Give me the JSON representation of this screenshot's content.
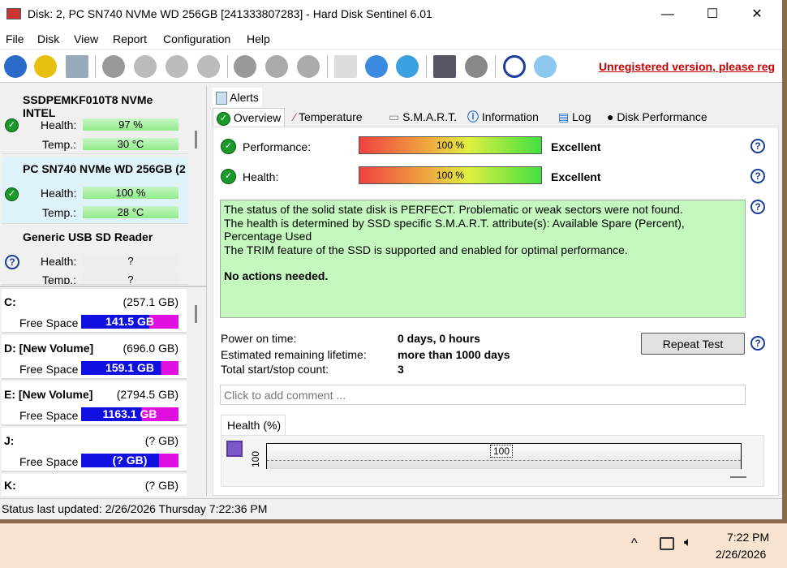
{
  "window": {
    "title": "Disk: 2, PC SN740 NVMe WD 256GB [241333807283]  -  Hard Disk Sentinel 6.01",
    "minimize": "—",
    "maximize": "☐",
    "close": "✕"
  },
  "menu": [
    "File",
    "Disk",
    "View",
    "Report",
    "Configuration",
    "Help"
  ],
  "toolbar": {
    "unregistered": "Unregistered version, please reg"
  },
  "disks": [
    {
      "name": "SSDPEMKF010T8 NVMe INTEL",
      "health_label": "Health:",
      "health": "97 %",
      "temp_label": "Temp.:",
      "temp": "30 °C",
      "status": "ok"
    },
    {
      "name": "PC SN740 NVMe WD 256GB (2",
      "health_label": "Health:",
      "health": "100 %",
      "temp_label": "Temp.:",
      "temp": "28 °C",
      "status": "ok"
    },
    {
      "name": "Generic USB SD Reader",
      "health_label": "Health:",
      "health": "?",
      "temp_label": "Temp.:",
      "temp": "?",
      "status": "unknown"
    }
  ],
  "partitions": [
    {
      "name": "C:",
      "size": "(257.1 GB)",
      "free_label": "Free Space",
      "free": "141.5 GB"
    },
    {
      "name": "D: [New Volume]",
      "size": "(696.0 GB)",
      "free_label": "Free Space",
      "free": "159.1 GB"
    },
    {
      "name": "E: [New Volume]",
      "size": "(2794.5 GB)",
      "free_label": "Free Space",
      "free": "1163.1 GB"
    },
    {
      "name": "J:",
      "size": "(? GB)",
      "free_label": "Free Space",
      "free": "(? GB)"
    },
    {
      "name": "K:",
      "size": "(? GB)"
    }
  ],
  "tabs": {
    "alerts": "Alerts",
    "items": [
      "Overview",
      "Temperature",
      "S.M.A.R.T.",
      "Information",
      "Log",
      "Disk Performance"
    ],
    "active": "Overview"
  },
  "overview": {
    "performance_label": "Performance:",
    "performance": "100 %",
    "performance_value": 100,
    "performance_rating": "Excellent",
    "health_label": "Health:",
    "health": "100 %",
    "health_value": 100,
    "health_rating": "Excellent",
    "status_lines": [
      "The status of the solid state disk is PERFECT. Problematic or weak sectors were not found.",
      "The health is determined by SSD specific S.M.A.R.T. attribute(s):  Available Spare (Percent), Percentage Used",
      "The TRIM feature of the SSD is supported and enabled for optimal performance."
    ],
    "actions": "No actions needed.",
    "power_on_label": "Power on time:",
    "power_on": "0 days, 0 hours",
    "lifetime_label": "Estimated remaining lifetime:",
    "lifetime": "more than 1000 days",
    "startstop_label": "Total start/stop count:",
    "startstop": "3",
    "repeat_test": "Repeat Test",
    "comment_placeholder": "Click to add comment ..."
  },
  "chart": {
    "tab": "Health (%)",
    "y_tick": "100",
    "point_label": "100"
  },
  "statusbar": "Status last updated: 2/26/2026 Thursday 7:22:36 PM",
  "taskbar": {
    "time": "7:22 PM",
    "date": "2/26/2026"
  },
  "colors": {
    "ok": "#1a9a2a",
    "status_bg": "#c3f7bd",
    "link": "#cc0000",
    "free_bar": "#1010e0"
  }
}
